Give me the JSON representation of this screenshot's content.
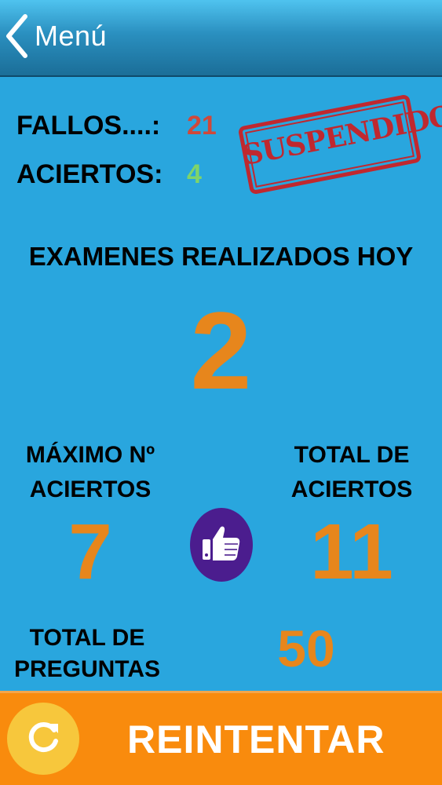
{
  "nav": {
    "back_label": "Menú",
    "back_icon": "chevron-left-icon"
  },
  "results": {
    "fallos_label": "FALLOS....:",
    "fallos_value": "21",
    "aciertos_label": "ACIERTOS:",
    "aciertos_value": "4",
    "stamp_text": "SUSPENDIDO"
  },
  "exams": {
    "title": "EXAMENES REALIZADOS HOY",
    "count": "2"
  },
  "stats": {
    "max_label_1": "MÁXIMO Nº",
    "max_label_2": "ACIERTOS",
    "max_value": "7",
    "total_aciertos_label_1": "TOTAL DE",
    "total_aciertos_label_2": "ACIERTOS",
    "total_aciertos_value": "11",
    "thumb_icon": "thumbs-up-icon",
    "total_preguntas_label_1": "TOTAL DE",
    "total_preguntas_label_2": "PREGUNTAS",
    "total_preguntas_value": "50"
  },
  "footer": {
    "retry_label": "REINTENTAR",
    "retry_icon": "refresh-icon"
  },
  "colors": {
    "background": "#29a6de",
    "fallos": "#d0483a",
    "aciertos": "#7fd46a",
    "accent_orange": "#e7861c",
    "stamp_red": "#c0282f",
    "footer_orange": "#f98b0d",
    "thumb_purple": "#4b1d8e"
  }
}
